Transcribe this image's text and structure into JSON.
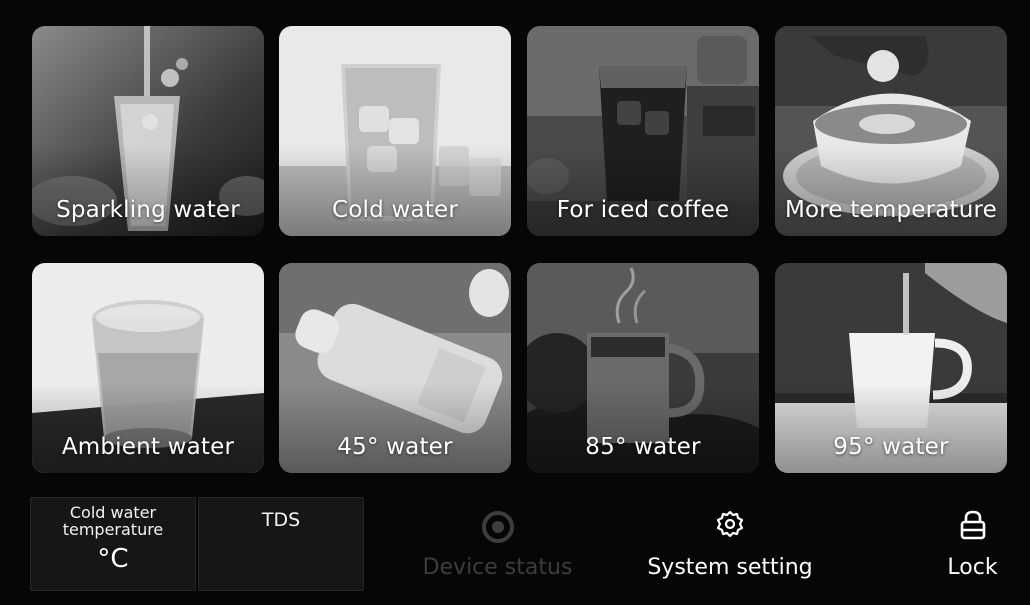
{
  "tiles": [
    {
      "label": "Sparkling water"
    },
    {
      "label": "Cold water"
    },
    {
      "label": "For iced coffee"
    },
    {
      "label": "More temperature"
    },
    {
      "label": "Ambient water"
    },
    {
      "label": "45° water"
    },
    {
      "label": "85° water"
    },
    {
      "label": "95° water"
    }
  ],
  "status": {
    "cold_water_temp": {
      "title": "Cold water temperature",
      "unit": "°C"
    },
    "tds": {
      "title": "TDS"
    }
  },
  "actions": {
    "device_status": {
      "label": "Device status",
      "icon": "target-icon",
      "enabled": false
    },
    "system_setting": {
      "label": "System setting",
      "icon": "gear-icon"
    },
    "lock": {
      "label": "Lock",
      "icon": "lock-icon"
    }
  },
  "colors": {
    "background": "#060606",
    "panel": "#161616",
    "text": "#ffffff",
    "disabled": "#3d3d3d"
  }
}
